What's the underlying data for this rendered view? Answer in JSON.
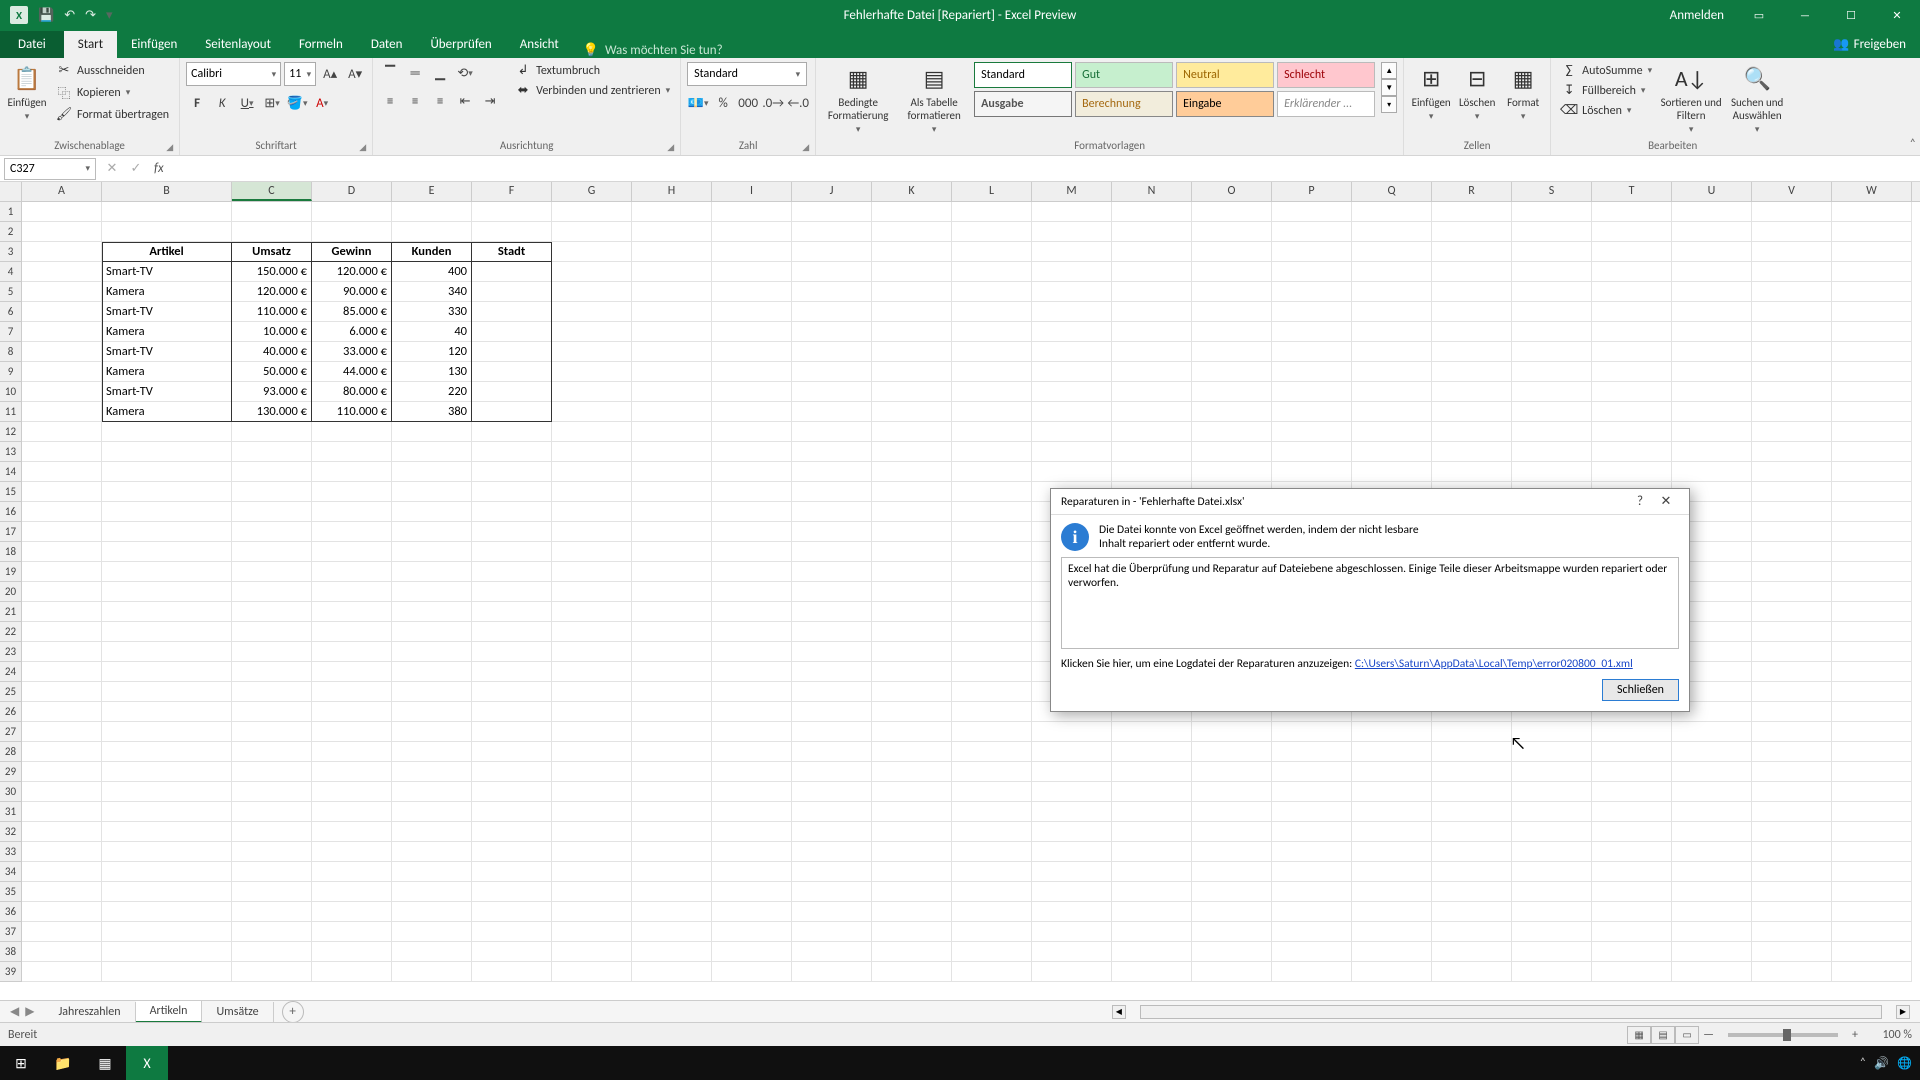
{
  "titlebar": {
    "title": "Fehlerhafte Datei [Repariert] - Excel Preview",
    "signin": "Anmelden"
  },
  "tabs": {
    "file": "Datei",
    "start": "Start",
    "einfuegen": "Einfügen",
    "seitenlayout": "Seitenlayout",
    "formeln": "Formeln",
    "daten": "Daten",
    "ueberpruefen": "Überprüfen",
    "ansicht": "Ansicht",
    "tellme_placeholder": "Was möchten Sie tun?",
    "share": "Freigeben"
  },
  "ribbon": {
    "clipboard": {
      "paste": "Einfügen",
      "cut": "Ausschneiden",
      "copy": "Kopieren",
      "format_painter": "Format übertragen",
      "label": "Zwischenablage"
    },
    "font": {
      "name": "Calibri",
      "size": "11",
      "label": "Schriftart"
    },
    "alignment": {
      "wrap": "Textumbruch",
      "merge": "Verbinden und zentrieren",
      "label": "Ausrichtung"
    },
    "number": {
      "format": "Standard",
      "label": "Zahl"
    },
    "styles": {
      "cond": "Bedingte Formatierung",
      "table": "Als Tabelle formatieren",
      "standard": "Standard",
      "gut": "Gut",
      "neutral": "Neutral",
      "schlecht": "Schlecht",
      "ausgabe": "Ausgabe",
      "berechnung": "Berechnung",
      "eingabe": "Eingabe",
      "erklaerend": "Erklärender ...",
      "label": "Formatvorlagen"
    },
    "cells": {
      "insert": "Einfügen",
      "delete": "Löschen",
      "format": "Format",
      "label": "Zellen"
    },
    "editing": {
      "autosum": "AutoSumme",
      "fill": "Füllbereich",
      "clear": "Löschen",
      "sort": "Sortieren und Filtern",
      "find": "Suchen und Auswählen",
      "label": "Bearbeiten"
    }
  },
  "namebox": "C327",
  "columns": [
    "A",
    "B",
    "C",
    "D",
    "E",
    "F",
    "G",
    "H",
    "I",
    "J",
    "K",
    "L",
    "M",
    "N",
    "O",
    "P",
    "Q",
    "R",
    "S",
    "T",
    "U",
    "V",
    "W"
  ],
  "table": {
    "headers": [
      "Artikel",
      "Umsatz",
      "Gewinn",
      "Kunden",
      "Stadt"
    ],
    "rows": [
      [
        "Smart-TV",
        "150.000 €",
        "120.000 €",
        "400",
        ""
      ],
      [
        "Kamera",
        "120.000 €",
        "90.000 €",
        "340",
        ""
      ],
      [
        "Smart-TV",
        "110.000 €",
        "85.000 €",
        "330",
        ""
      ],
      [
        "Kamera",
        "10.000 €",
        "6.000 €",
        "40",
        ""
      ],
      [
        "Smart-TV",
        "40.000 €",
        "33.000 €",
        "120",
        ""
      ],
      [
        "Kamera",
        "50.000 €",
        "44.000 €",
        "130",
        ""
      ],
      [
        "Smart-TV",
        "93.000 €",
        "80.000 €",
        "220",
        ""
      ],
      [
        "Kamera",
        "130.000 €",
        "110.000 €",
        "380",
        ""
      ]
    ]
  },
  "sheets": {
    "s1": "Jahreszahlen",
    "s2": "Artikeln",
    "s3": "Umsätze"
  },
  "status": {
    "ready": "Bereit",
    "zoom": "100 %"
  },
  "dialog": {
    "title": "Reparaturen in - 'Fehlerhafte Datei.xlsx'",
    "message": "Die Datei konnte von Excel geöffnet werden, indem der nicht lesbare Inhalt repariert oder entfernt wurde.",
    "details": "Excel hat die Überprüfung und Reparatur auf Dateiebene abgeschlossen. Einige Teile dieser Arbeitsmappe wurden repariert oder verworfen.",
    "log_label": "Klicken Sie hier, um eine Logdatei der Reparaturen anzuzeigen:",
    "log_link": "C:\\Users\\Saturn\\AppData\\Local\\Temp\\error020800_01.xml",
    "close_btn": "Schließen"
  }
}
